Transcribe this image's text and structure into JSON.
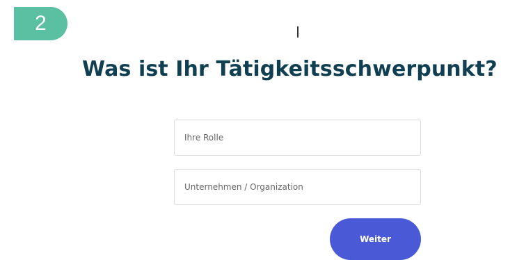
{
  "step": {
    "number": "2"
  },
  "page": {
    "title": "Was ist Ihr Tätigkeitsschwerpunkt?"
  },
  "form": {
    "role_field": {
      "placeholder": "Ihre Rolle",
      "value": ""
    },
    "organization_field": {
      "placeholder": "Unternehmen / Organization",
      "value": ""
    },
    "submit_label": "Weiter"
  },
  "colors": {
    "step_badge": "#5bbfa1",
    "title": "#0f3f50",
    "submit_button": "#4a5ad6",
    "field_border": "#dcdcdc"
  }
}
